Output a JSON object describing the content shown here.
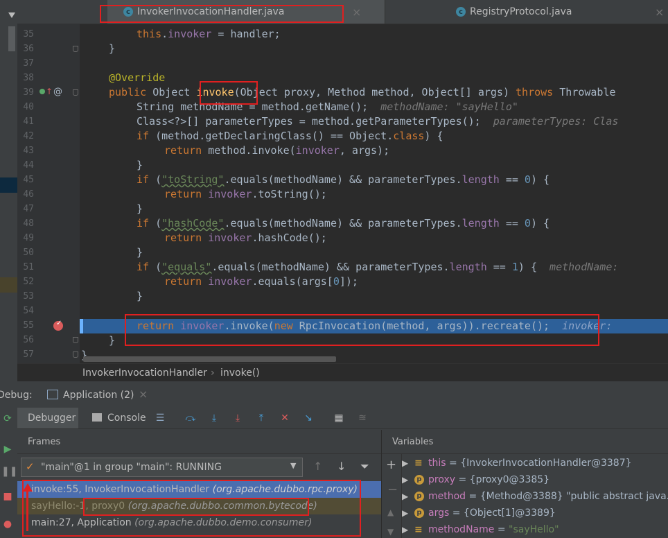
{
  "tabs": [
    {
      "label": "InvokerInvocationHandler.java",
      "icon": "class-icon"
    },
    {
      "label": "RegistryProtocol.java",
      "icon": "class-icon"
    }
  ],
  "line_numbers": [
    "35",
    "36",
    "37",
    "38",
    "39",
    "40",
    "41",
    "42",
    "43",
    "44",
    "45",
    "46",
    "47",
    "48",
    "49",
    "50",
    "51",
    "52",
    "53",
    "54",
    "55",
    "56",
    "57"
  ],
  "code": {
    "l35": {
      "a": "this",
      "b": ".",
      "c": "invoker",
      "d": " = handler;"
    },
    "l36": "}",
    "l38": "@Override",
    "l39": {
      "kw": "public",
      "t1": " Object ",
      "m": "invoke",
      "t2": "(Object proxy, Method method, Object[] args) ",
      "kw2": "throws",
      "t3": " Throwable"
    },
    "l40": {
      "t": "String methodName = method.getName();",
      "h": "methodName: \"sayHello\""
    },
    "l41": {
      "t": "Class<?>[] parameterTypes = method.getParameterTypes();",
      "h": "parameterTypes: Clas"
    },
    "l42": {
      "kw": "if",
      "t1": " (method.getDeclaringClass() == Object.",
      "kw2": "class",
      "t2": ") {"
    },
    "l43": {
      "kw": "return",
      "t1": " method.invoke(",
      "f": "invoker",
      "t2": ", args);"
    },
    "l44": "}",
    "l45": {
      "kw": "if",
      "t1": " (",
      "s": "\"toString\"",
      "t2": ".equals(methodName) && parameterTypes.",
      "f": "length",
      "t3": " == ",
      "n": "0",
      "t4": ") {"
    },
    "l46": {
      "kw": "return",
      "f": "invoker",
      "t1": ".toString();"
    },
    "l47": "}",
    "l48": {
      "kw": "if",
      "t1": " (",
      "s": "\"hashCode\"",
      "t2": ".equals(methodName) && parameterTypes.",
      "f": "length",
      "t3": " == ",
      "n": "0",
      "t4": ") {"
    },
    "l49": {
      "kw": "return",
      "f": "invoker",
      "t1": ".hashCode();"
    },
    "l50": "}",
    "l51": {
      "kw": "if",
      "t1": " (",
      "s": "\"equals\"",
      "t2": ".equals(methodName) && parameterTypes.",
      "f": "length",
      "t3": " == ",
      "n": "1",
      "t4": ") {",
      "h": "methodName:"
    },
    "l52": {
      "kw": "return",
      "f": "invoker",
      "t1": ".equals(args[",
      "n": "0",
      "t2": "]);"
    },
    "l53": "}",
    "l55": {
      "kw": "return",
      "f": "invoker",
      "t1": ".invoke(",
      "kw2": "new",
      "t2": " RpcInvocation(method, args)).recreate();",
      "h": "invoker:"
    },
    "l56": "}",
    "l57": "}"
  },
  "breadcrumb": [
    "InvokerInvocationHandler",
    "invoke()"
  ],
  "breadcrumb_sep": "›",
  "debug": {
    "label": "Debug:",
    "config": "Application (2)",
    "tabs": [
      "Debugger",
      "Console"
    ]
  },
  "frames_title": "Frames",
  "variables_title": "Variables",
  "thread": "\"main\"@1 in group \"main\": RUNNING",
  "frames": [
    {
      "m": "invoke:55, InvokerInvocationHandler",
      "p": "(org.apache.dubbo.rpc.proxy)"
    },
    {
      "m": "sayHello:-1, proxy0",
      "p": "(org.apache.dubbo.common.bytecode)"
    },
    {
      "m": "main:27, Application",
      "p": "(org.apache.dubbo.demo.consumer)"
    }
  ],
  "variables": [
    {
      "kind": "this",
      "name": "this",
      "value": " = {InvokerInvocationHandler@3387}"
    },
    {
      "kind": "p",
      "name": "proxy",
      "value": " = {proxy0@3385}"
    },
    {
      "kind": "p",
      "name": "method",
      "value": " = {Method@3388} \"public abstract java.la"
    },
    {
      "kind": "p",
      "name": "args",
      "value": " = {Object[1]@3389}"
    },
    {
      "kind": "local",
      "name": "methodName",
      "value": " = ",
      "str": "\"sayHello\""
    }
  ],
  "colors": {
    "accent": "#2d6099",
    "annotation": "#e02020",
    "breakpoint": "#db5c5c"
  }
}
